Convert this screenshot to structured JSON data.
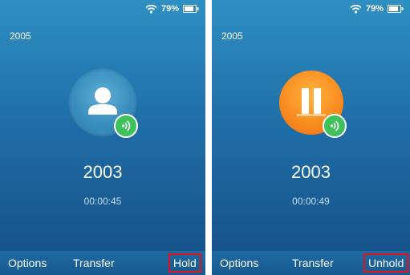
{
  "left": {
    "status": {
      "wifi_icon": "wifi-icon",
      "battery_percent": "79%",
      "battery_icon": "battery-icon"
    },
    "extension": "2005",
    "avatar": {
      "icon": "person-icon",
      "badge_icon": "call-active-icon",
      "color": "#3a8fbd"
    },
    "callee_number": "2003",
    "call_timer": "00:00:45",
    "softkeys": {
      "options": "Options",
      "transfer": "Transfer",
      "hold": "Hold"
    }
  },
  "right": {
    "status": {
      "wifi_icon": "wifi-icon",
      "battery_percent": "79%",
      "battery_icon": "battery-icon"
    },
    "extension": "2005",
    "avatar": {
      "icon": "pause-icon",
      "badge_icon": "call-active-icon",
      "color": "#f98e20"
    },
    "callee_number": "2003",
    "call_timer": "00:00:49",
    "softkeys": {
      "options": "Options",
      "transfer": "Transfer",
      "unhold": "Unhold"
    }
  },
  "highlight_color": "#e0141a"
}
